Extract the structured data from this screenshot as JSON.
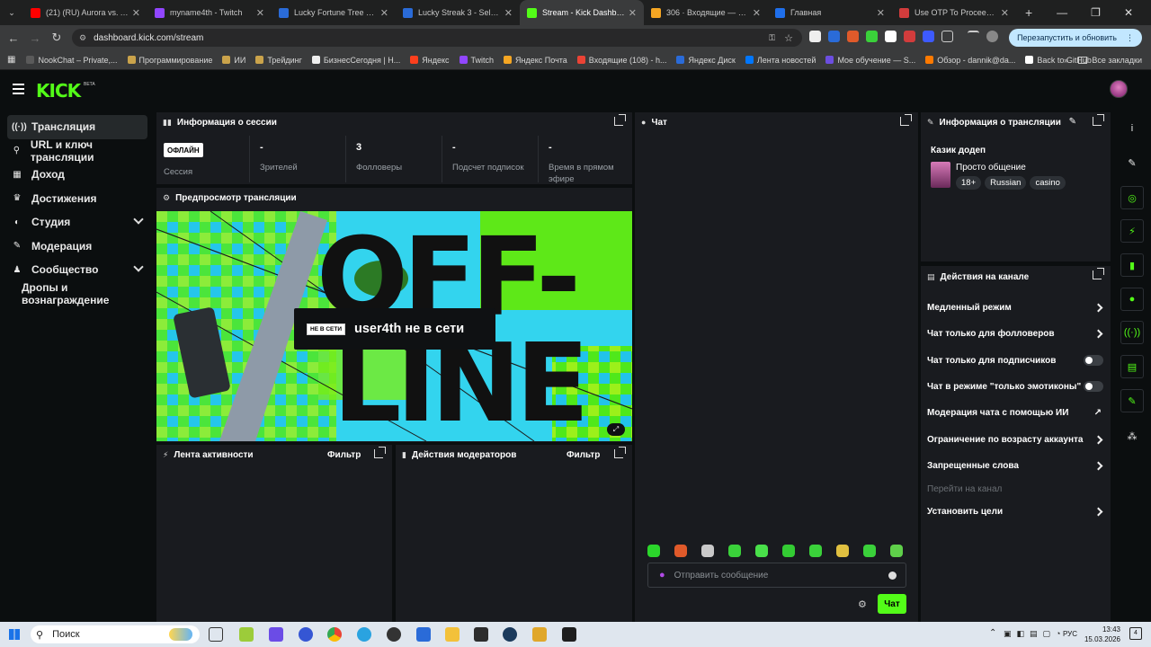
{
  "browser": {
    "tabs": [
      {
        "title": "(21) (RU) Aurora vs. Astral",
        "color": "#ff0000",
        "active": false
      },
      {
        "title": "myname4th - Twitch",
        "color": "#9146ff",
        "active": false
      },
      {
        "title": "Lucky Fortune Tree - Selector",
        "color": "#2a6bd8",
        "active": false
      },
      {
        "title": "Lucky Streak 3 - Selector",
        "color": "#2a6bd8",
        "active": false
      },
      {
        "title": "Stream - Kick Dashboard",
        "color": "#53fc18",
        "active": true
      },
      {
        "title": "306 · Входящие — Яндекс",
        "color": "#f5a623",
        "active": false
      },
      {
        "title": "Главная",
        "color": "#1f6feb",
        "active": false
      },
      {
        "title": "Use OTP To Proceed - hay",
        "color": "#d23c3c",
        "active": false
      }
    ],
    "url": "dashboard.kick.com/stream",
    "relaunch_label": "Перезапустить и обновить",
    "bookmarks": [
      {
        "label": "NookChat – Private,...",
        "color": "#5a5a5a"
      },
      {
        "label": "Программирование",
        "color": "#caa34b"
      },
      {
        "label": "ИИ",
        "color": "#caa34b"
      },
      {
        "label": "Трейдинг",
        "color": "#caa34b"
      },
      {
        "label": "БизнесСегодня | Н...",
        "color": "#eeeeee"
      },
      {
        "label": "Яндекс",
        "color": "#fc3f1d"
      },
      {
        "label": "Twitch",
        "color": "#9146ff"
      },
      {
        "label": "Яндекс Почта",
        "color": "#f5a623"
      },
      {
        "label": "Входящие (108) - h...",
        "color": "#ea4335"
      },
      {
        "label": "Яндекс Диск",
        "color": "#2a6bd8"
      },
      {
        "label": "Лента новостей",
        "color": "#0077ff"
      },
      {
        "label": "Мое обучение — S...",
        "color": "#6c4ee0"
      },
      {
        "label": "Обзор - dannik@da...",
        "color": "#ff7a00"
      },
      {
        "label": "Back to GitHub",
        "color": "#ffffff"
      }
    ],
    "all_bookmarks": "Все закладки"
  },
  "kick": {
    "logo": "KICK",
    "beta": "BETA",
    "sidebar": [
      {
        "label": "Трансляция",
        "icon": "broadcast-icon",
        "glyph": "((·))",
        "active": true,
        "chev": false
      },
      {
        "label": "URL и ключ трансляции",
        "icon": "key-icon",
        "glyph": "⚲",
        "active": false,
        "chev": false
      },
      {
        "label": "Доход",
        "icon": "bank-icon",
        "glyph": "▦",
        "active": false,
        "chev": false
      },
      {
        "label": "Достижения",
        "icon": "trophy-icon",
        "glyph": "♛",
        "active": false,
        "chev": false
      },
      {
        "label": "Студия",
        "icon": "palette-icon",
        "glyph": "◐",
        "active": false,
        "chev": true
      },
      {
        "label": "Модерация",
        "icon": "wrench-icon",
        "glyph": "✎",
        "active": false,
        "chev": false
      },
      {
        "label": "Сообщество",
        "icon": "users-icon",
        "glyph": "♟",
        "active": false,
        "chev": true
      },
      {
        "label": "Дропы и вознаграждение",
        "icon": "",
        "glyph": "",
        "active": false,
        "chev": false
      }
    ],
    "session": {
      "title": "Информация о сессии",
      "badge": "ОФЛАЙН",
      "session_label": "Сессия",
      "stats": [
        {
          "value": "-",
          "label": "Зрителей"
        },
        {
          "value": "3",
          "label": "Фолловеры"
        },
        {
          "value": "-",
          "label": "Подсчет подписок"
        },
        {
          "value": "-",
          "label": "Время в прямом эфире"
        }
      ]
    },
    "preview": {
      "title": "Предпросмотр трансляции",
      "big_text_1": "OFF-",
      "big_text_2": "LINE",
      "offline_badge": "НЕ В СЕТИ",
      "offline_text": "user4th не в сети"
    },
    "activity": {
      "title": "Лента активности",
      "filter": "Фильтр"
    },
    "mod_actions": {
      "title": "Действия модераторов",
      "filter": "Фильтр"
    },
    "chat": {
      "title": "Чат",
      "placeholder": "Отправить сообщение",
      "send_label": "Чат",
      "emotes": [
        "#2bd62b",
        "#e05a2a",
        "#c9c9c9",
        "#3ad13a",
        "#49e04a",
        "#33cc33",
        "#3ad13a",
        "#e0c040",
        "#3ad13a",
        "#5fd04a"
      ]
    },
    "stream_info": {
      "title": "Информация о трансляции",
      "stream_title": "Казик додеп",
      "category": "Просто общение",
      "tags": [
        "18+",
        "Russian",
        "casino"
      ]
    },
    "channel_actions": {
      "title": "Действия на канале",
      "items": [
        {
          "label": "Медленный режим",
          "type": "arrow"
        },
        {
          "label": "Чат только для фолловеров",
          "type": "arrow"
        },
        {
          "label": "Чат только для подписчиков",
          "type": "toggle",
          "on": false
        },
        {
          "label": "Чат в режиме \"только эмотиконы\"",
          "type": "toggle",
          "on": false
        },
        {
          "label": "Модерация чата с помощью ИИ",
          "type": "external"
        },
        {
          "label": "Ограничение по возрасту аккаунта",
          "type": "arrow"
        },
        {
          "label": "Запрещенные слова",
          "type": "arrow"
        },
        {
          "label": "Перейти на канал",
          "type": "disabled"
        },
        {
          "label": "Установить цели",
          "type": "arrow"
        }
      ]
    },
    "rail_icons": [
      "info-icon",
      "edit-icon",
      "scan-icon",
      "lightning-icon",
      "clipboard-icon",
      "chat-bubble-icon",
      "broadcast-icon",
      "archive-icon",
      "wrench-icon",
      "connections-icon"
    ]
  },
  "taskbar": {
    "search_placeholder": "Поиск",
    "lang": "РУС",
    "time": "13:43",
    "date": "15.03.2026",
    "notif_count": "4"
  }
}
